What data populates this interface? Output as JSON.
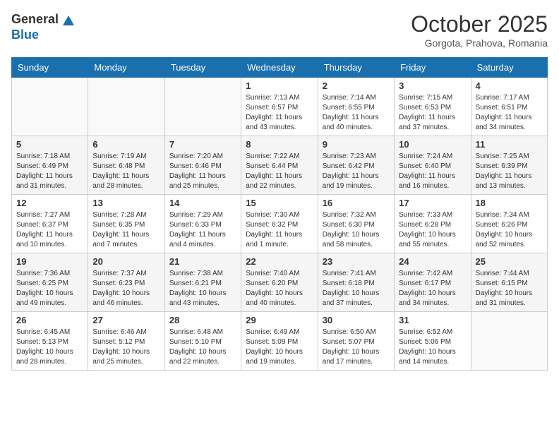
{
  "header": {
    "logo_general": "General",
    "logo_blue": "Blue",
    "month_title": "October 2025",
    "location": "Gorgota, Prahova, Romania"
  },
  "weekdays": [
    "Sunday",
    "Monday",
    "Tuesday",
    "Wednesday",
    "Thursday",
    "Friday",
    "Saturday"
  ],
  "weeks": [
    [
      {
        "day": "",
        "sunrise": "",
        "sunset": "",
        "daylight": ""
      },
      {
        "day": "",
        "sunrise": "",
        "sunset": "",
        "daylight": ""
      },
      {
        "day": "",
        "sunrise": "",
        "sunset": "",
        "daylight": ""
      },
      {
        "day": "1",
        "sunrise": "Sunrise: 7:13 AM",
        "sunset": "Sunset: 6:57 PM",
        "daylight": "Daylight: 11 hours and 43 minutes."
      },
      {
        "day": "2",
        "sunrise": "Sunrise: 7:14 AM",
        "sunset": "Sunset: 6:55 PM",
        "daylight": "Daylight: 11 hours and 40 minutes."
      },
      {
        "day": "3",
        "sunrise": "Sunrise: 7:15 AM",
        "sunset": "Sunset: 6:53 PM",
        "daylight": "Daylight: 11 hours and 37 minutes."
      },
      {
        "day": "4",
        "sunrise": "Sunrise: 7:17 AM",
        "sunset": "Sunset: 6:51 PM",
        "daylight": "Daylight: 11 hours and 34 minutes."
      }
    ],
    [
      {
        "day": "5",
        "sunrise": "Sunrise: 7:18 AM",
        "sunset": "Sunset: 6:49 PM",
        "daylight": "Daylight: 11 hours and 31 minutes."
      },
      {
        "day": "6",
        "sunrise": "Sunrise: 7:19 AM",
        "sunset": "Sunset: 6:48 PM",
        "daylight": "Daylight: 11 hours and 28 minutes."
      },
      {
        "day": "7",
        "sunrise": "Sunrise: 7:20 AM",
        "sunset": "Sunset: 6:46 PM",
        "daylight": "Daylight: 11 hours and 25 minutes."
      },
      {
        "day": "8",
        "sunrise": "Sunrise: 7:22 AM",
        "sunset": "Sunset: 6:44 PM",
        "daylight": "Daylight: 11 hours and 22 minutes."
      },
      {
        "day": "9",
        "sunrise": "Sunrise: 7:23 AM",
        "sunset": "Sunset: 6:42 PM",
        "daylight": "Daylight: 11 hours and 19 minutes."
      },
      {
        "day": "10",
        "sunrise": "Sunrise: 7:24 AM",
        "sunset": "Sunset: 6:40 PM",
        "daylight": "Daylight: 11 hours and 16 minutes."
      },
      {
        "day": "11",
        "sunrise": "Sunrise: 7:25 AM",
        "sunset": "Sunset: 6:39 PM",
        "daylight": "Daylight: 11 hours and 13 minutes."
      }
    ],
    [
      {
        "day": "12",
        "sunrise": "Sunrise: 7:27 AM",
        "sunset": "Sunset: 6:37 PM",
        "daylight": "Daylight: 11 hours and 10 minutes."
      },
      {
        "day": "13",
        "sunrise": "Sunrise: 7:28 AM",
        "sunset": "Sunset: 6:35 PM",
        "daylight": "Daylight: 11 hours and 7 minutes."
      },
      {
        "day": "14",
        "sunrise": "Sunrise: 7:29 AM",
        "sunset": "Sunset: 6:33 PM",
        "daylight": "Daylight: 11 hours and 4 minutes."
      },
      {
        "day": "15",
        "sunrise": "Sunrise: 7:30 AM",
        "sunset": "Sunset: 6:32 PM",
        "daylight": "Daylight: 11 hours and 1 minute."
      },
      {
        "day": "16",
        "sunrise": "Sunrise: 7:32 AM",
        "sunset": "Sunset: 6:30 PM",
        "daylight": "Daylight: 10 hours and 58 minutes."
      },
      {
        "day": "17",
        "sunrise": "Sunrise: 7:33 AM",
        "sunset": "Sunset: 6:28 PM",
        "daylight": "Daylight: 10 hours and 55 minutes."
      },
      {
        "day": "18",
        "sunrise": "Sunrise: 7:34 AM",
        "sunset": "Sunset: 6:26 PM",
        "daylight": "Daylight: 10 hours and 52 minutes."
      }
    ],
    [
      {
        "day": "19",
        "sunrise": "Sunrise: 7:36 AM",
        "sunset": "Sunset: 6:25 PM",
        "daylight": "Daylight: 10 hours and 49 minutes."
      },
      {
        "day": "20",
        "sunrise": "Sunrise: 7:37 AM",
        "sunset": "Sunset: 6:23 PM",
        "daylight": "Daylight: 10 hours and 46 minutes."
      },
      {
        "day": "21",
        "sunrise": "Sunrise: 7:38 AM",
        "sunset": "Sunset: 6:21 PM",
        "daylight": "Daylight: 10 hours and 43 minutes."
      },
      {
        "day": "22",
        "sunrise": "Sunrise: 7:40 AM",
        "sunset": "Sunset: 6:20 PM",
        "daylight": "Daylight: 10 hours and 40 minutes."
      },
      {
        "day": "23",
        "sunrise": "Sunrise: 7:41 AM",
        "sunset": "Sunset: 6:18 PM",
        "daylight": "Daylight: 10 hours and 37 minutes."
      },
      {
        "day": "24",
        "sunrise": "Sunrise: 7:42 AM",
        "sunset": "Sunset: 6:17 PM",
        "daylight": "Daylight: 10 hours and 34 minutes."
      },
      {
        "day": "25",
        "sunrise": "Sunrise: 7:44 AM",
        "sunset": "Sunset: 6:15 PM",
        "daylight": "Daylight: 10 hours and 31 minutes."
      }
    ],
    [
      {
        "day": "26",
        "sunrise": "Sunrise: 6:45 AM",
        "sunset": "Sunset: 5:13 PM",
        "daylight": "Daylight: 10 hours and 28 minutes."
      },
      {
        "day": "27",
        "sunrise": "Sunrise: 6:46 AM",
        "sunset": "Sunset: 5:12 PM",
        "daylight": "Daylight: 10 hours and 25 minutes."
      },
      {
        "day": "28",
        "sunrise": "Sunrise: 6:48 AM",
        "sunset": "Sunset: 5:10 PM",
        "daylight": "Daylight: 10 hours and 22 minutes."
      },
      {
        "day": "29",
        "sunrise": "Sunrise: 6:49 AM",
        "sunset": "Sunset: 5:09 PM",
        "daylight": "Daylight: 10 hours and 19 minutes."
      },
      {
        "day": "30",
        "sunrise": "Sunrise: 6:50 AM",
        "sunset": "Sunset: 5:07 PM",
        "daylight": "Daylight: 10 hours and 17 minutes."
      },
      {
        "day": "31",
        "sunrise": "Sunrise: 6:52 AM",
        "sunset": "Sunset: 5:06 PM",
        "daylight": "Daylight: 10 hours and 14 minutes."
      },
      {
        "day": "",
        "sunrise": "",
        "sunset": "",
        "daylight": ""
      }
    ]
  ]
}
